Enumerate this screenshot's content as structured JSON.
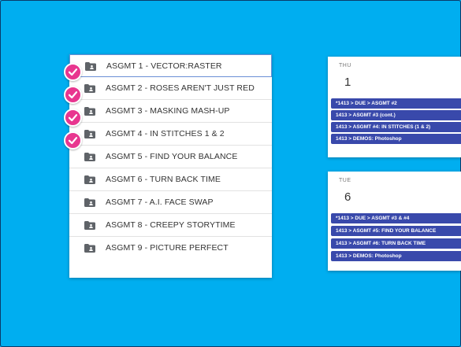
{
  "folders": [
    {
      "label": "ASGMT 1 - VECTOR:RASTER",
      "checked": true
    },
    {
      "label": "ASGMT 2 - ROSES AREN'T JUST RED",
      "checked": true
    },
    {
      "label": "ASGMT 3 - MASKING MASH-UP",
      "checked": true
    },
    {
      "label": "ASGMT 4 - IN STITCHES 1 & 2",
      "checked": true
    },
    {
      "label": "ASGMT 5 - FIND YOUR BALANCE",
      "checked": false
    },
    {
      "label": "ASGMT 6 - TURN BACK TIME",
      "checked": false
    },
    {
      "label": "ASGMT 7 - A.I. FACE SWAP",
      "checked": false
    },
    {
      "label": "ASGMT 8 - CREEPY STORYTIME",
      "checked": false
    },
    {
      "label": "ASGMT 9 - PICTURE PERFECT",
      "checked": false
    }
  ],
  "calendar": [
    {
      "dow": "THU",
      "day": "1",
      "events": [
        "*1413 > DUE > ASGMT #2",
        "1413 > ASGMT #3 (cont.)",
        "1413 > ASGMT #4: IN STITCHES (1 & 2)",
        "1413 > DEMOS: Photoshop"
      ]
    },
    {
      "dow": "TUE",
      "day": "6",
      "events": [
        "*1413 > DUE > ASGMT #3 & #4",
        "1413 > ASGMT #5: FIND YOUR BALANCE",
        "1413 > ASGMT #6: TURN BACK TIME",
        "1413 > DEMOS: Photoshop"
      ]
    }
  ],
  "colors": {
    "background": "#00aef0",
    "check": "#e8368f",
    "event": "#3949ab",
    "folder_icon": "#5f6368"
  },
  "icons": {
    "folder": "shared-folder-icon",
    "check": "checkmark-icon"
  }
}
